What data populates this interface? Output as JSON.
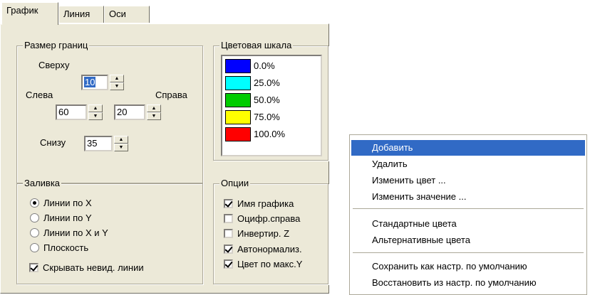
{
  "tabs": [
    {
      "label": "График",
      "active": true
    },
    {
      "label": "Линия",
      "active": false
    },
    {
      "label": "Оси",
      "active": false
    }
  ],
  "borders": {
    "title": "Размер границ",
    "top_label": "Сверху",
    "top_value": "10",
    "left_label": "Слева",
    "left_value": "60",
    "right_label": "Справа",
    "right_value": "20",
    "bottom_label": "Снизу",
    "bottom_value": "35"
  },
  "color_scale": {
    "title": "Цветовая шкала",
    "items": [
      {
        "color": "#0000ff",
        "value": "0.0%"
      },
      {
        "color": "#00ffff",
        "value": "25.0%"
      },
      {
        "color": "#00cc00",
        "value": "50.0%"
      },
      {
        "color": "#ffff00",
        "value": "75.0%"
      },
      {
        "color": "#ff0000",
        "value": "100.0%"
      }
    ]
  },
  "fill": {
    "title": "Заливка",
    "options": [
      {
        "label": "Линии по X",
        "selected": true
      },
      {
        "label": "Линии по Y",
        "selected": false
      },
      {
        "label": "Линии по X и Y",
        "selected": false
      },
      {
        "label": "Плоскость",
        "selected": false
      }
    ],
    "hide_lines_label": "Скрывать невид. линии",
    "hide_lines_checked": true
  },
  "options": {
    "title": "Опции",
    "items": [
      {
        "label": "Имя графика",
        "checked": true
      },
      {
        "label": "Оцифр.справа",
        "checked": false
      },
      {
        "label": "Инвертир. Z",
        "checked": false
      },
      {
        "label": "Автонормализ.",
        "checked": true
      },
      {
        "label": "Цвет по макс.Y",
        "checked": true
      }
    ]
  },
  "context_menu": {
    "items": [
      {
        "label": "Добавить",
        "highlighted": true
      },
      {
        "label": "Удалить"
      },
      {
        "label": "Изменить цвет ..."
      },
      {
        "label": "Изменить значение ..."
      },
      {
        "label": "Стандартные цвета"
      },
      {
        "label": "Альтернативные цвета"
      },
      {
        "label": "Сохранить как настр. по умолчанию"
      },
      {
        "label": "Восстановить из настр. по умолчанию"
      }
    ]
  },
  "colors": {
    "dialog_bg": "#ece9d8",
    "highlight": "#316ac5"
  }
}
